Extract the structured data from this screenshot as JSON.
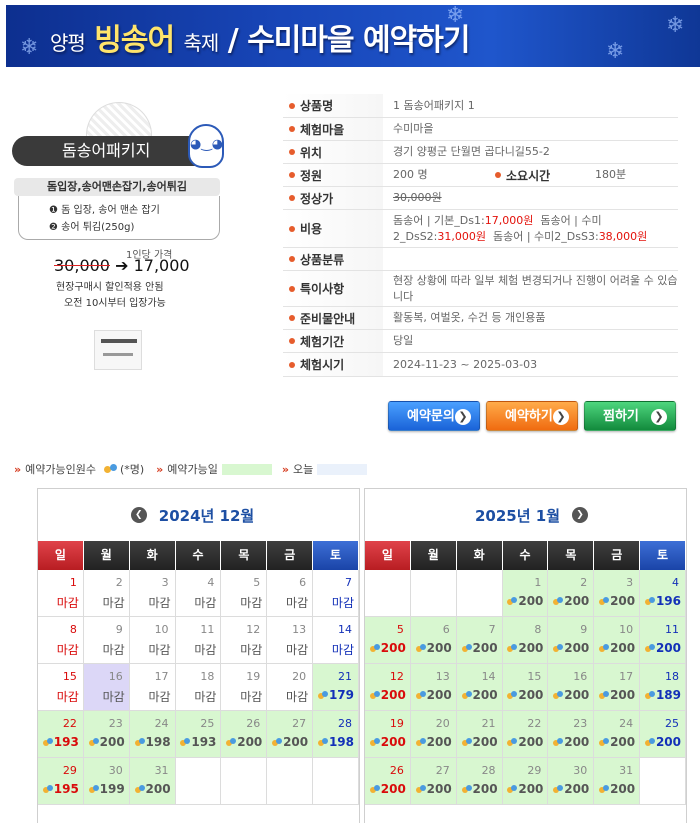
{
  "banner": {
    "part1": "양평",
    "part2": "빙송어",
    "part3": "축제",
    "part4": "/ 수미마을 예약하기"
  },
  "product_image": {
    "pill": "돔송어패키지",
    "subtitle": "돔입장,송어맨손잡기,송어튀김",
    "item1": "❶ 돔 입장, 송어 맨손 잡기",
    "item2": "❷ 송어 튀김(250g)",
    "price_label": "1인당 가격",
    "old_price": "30,000",
    "arrow": "➔",
    "new_price": "17,000",
    "note1": "현장구매시 할인적용 안됨",
    "note2": "오전 10시부터 입장가능"
  },
  "info": {
    "product_name_label": "상품명",
    "product_name": "1 돔송어패키지 1",
    "village_label": "체험마을",
    "village": "수미마을",
    "location_label": "위치",
    "location": "경기 양평군 단월면 곱다니길55-2",
    "capacity_label": "정원",
    "capacity": "200 명",
    "duration_label": "소요시간",
    "duration": "180분",
    "list_price_label": "정상가",
    "list_price": "30,000원",
    "cost_label": "비용",
    "cost_a1": "돔송어 | 기본_Ds1:",
    "cost_a2": "17,000원",
    "cost_b1": "돔송어 | 수미",
    "cost_b2": "2_DsS2:",
    "cost_b3": "31,000원",
    "cost_c1": "돔송어 | 수미2_DsS3:",
    "cost_c2": "38,000원",
    "category_label": "상품분류",
    "category": "",
    "special_label": "특이사항",
    "special": "현장 상황에 따라 일부 체험 변경되거나 진행이 어려울 수 있습니다",
    "prep_label": "준비물안내",
    "prep": "활동복, 여벌옷, 수건 등 개인용품",
    "period_label": "체험기간",
    "period": "당일",
    "time_label": "체험시기",
    "time": "2024-11-23 ~ 2025-03-03"
  },
  "buttons": {
    "inquiry": "예약문의",
    "reserve": "예약하기",
    "favorite": "찜하기"
  },
  "legend": {
    "marker": "»",
    "capacity": "예약가능인원수",
    "capacity_unit": "(*명)",
    "available": "예약가능일",
    "today": "오늘",
    "available_color": "#d8f7d0",
    "today_color": "#eaf1fb"
  },
  "weekdays": [
    "일",
    "월",
    "화",
    "수",
    "목",
    "금",
    "토"
  ],
  "calendars": [
    {
      "title": "2024년 12월",
      "nav": "prev",
      "offset": 0,
      "today": 16,
      "days": [
        {
          "d": "1",
          "s": "마감"
        },
        {
          "d": "2",
          "s": "마감"
        },
        {
          "d": "3",
          "s": "마감"
        },
        {
          "d": "4",
          "s": "마감"
        },
        {
          "d": "5",
          "s": "마감"
        },
        {
          "d": "6",
          "s": "마감"
        },
        {
          "d": "7",
          "s": "마감"
        },
        {
          "d": "8",
          "s": "마감"
        },
        {
          "d": "9",
          "s": "마감"
        },
        {
          "d": "10",
          "s": "마감"
        },
        {
          "d": "11",
          "s": "마감"
        },
        {
          "d": "12",
          "s": "마감"
        },
        {
          "d": "13",
          "s": "마감"
        },
        {
          "d": "14",
          "s": "마감"
        },
        {
          "d": "15",
          "s": "마감"
        },
        {
          "d": "16",
          "s": "마감"
        },
        {
          "d": "17",
          "s": "마감"
        },
        {
          "d": "18",
          "s": "마감"
        },
        {
          "d": "19",
          "s": "마감"
        },
        {
          "d": "20",
          "s": "마감"
        },
        {
          "d": "21",
          "s": "179",
          "open": true
        },
        {
          "d": "22",
          "s": "193",
          "open": true
        },
        {
          "d": "23",
          "s": "200",
          "open": true
        },
        {
          "d": "24",
          "s": "198",
          "open": true
        },
        {
          "d": "25",
          "s": "193",
          "open": true
        },
        {
          "d": "26",
          "s": "200",
          "open": true
        },
        {
          "d": "27",
          "s": "200",
          "open": true
        },
        {
          "d": "28",
          "s": "198",
          "open": true
        },
        {
          "d": "29",
          "s": "195",
          "open": true
        },
        {
          "d": "30",
          "s": "199",
          "open": true
        },
        {
          "d": "31",
          "s": "200",
          "open": true
        }
      ]
    },
    {
      "title": "2025년 1월",
      "nav": "next",
      "offset": 3,
      "today": 0,
      "days": [
        {
          "d": "1",
          "s": "200",
          "open": true
        },
        {
          "d": "2",
          "s": "200",
          "open": true
        },
        {
          "d": "3",
          "s": "200",
          "open": true
        },
        {
          "d": "4",
          "s": "196",
          "open": true
        },
        {
          "d": "5",
          "s": "200",
          "open": true
        },
        {
          "d": "6",
          "s": "200",
          "open": true
        },
        {
          "d": "7",
          "s": "200",
          "open": true
        },
        {
          "d": "8",
          "s": "200",
          "open": true
        },
        {
          "d": "9",
          "s": "200",
          "open": true
        },
        {
          "d": "10",
          "s": "200",
          "open": true
        },
        {
          "d": "11",
          "s": "200",
          "open": true
        },
        {
          "d": "12",
          "s": "200",
          "open": true
        },
        {
          "d": "13",
          "s": "200",
          "open": true
        },
        {
          "d": "14",
          "s": "200",
          "open": true
        },
        {
          "d": "15",
          "s": "200",
          "open": true
        },
        {
          "d": "16",
          "s": "200",
          "open": true
        },
        {
          "d": "17",
          "s": "200",
          "open": true
        },
        {
          "d": "18",
          "s": "189",
          "open": true
        },
        {
          "d": "19",
          "s": "200",
          "open": true
        },
        {
          "d": "20",
          "s": "200",
          "open": true
        },
        {
          "d": "21",
          "s": "200",
          "open": true
        },
        {
          "d": "22",
          "s": "200",
          "open": true
        },
        {
          "d": "23",
          "s": "200",
          "open": true
        },
        {
          "d": "24",
          "s": "200",
          "open": true
        },
        {
          "d": "25",
          "s": "200",
          "open": true
        },
        {
          "d": "26",
          "s": "200",
          "open": true
        },
        {
          "d": "27",
          "s": "200",
          "open": true
        },
        {
          "d": "28",
          "s": "200",
          "open": true
        },
        {
          "d": "29",
          "s": "200",
          "open": true
        },
        {
          "d": "30",
          "s": "200",
          "open": true
        },
        {
          "d": "31",
          "s": "200",
          "open": true
        }
      ]
    }
  ]
}
